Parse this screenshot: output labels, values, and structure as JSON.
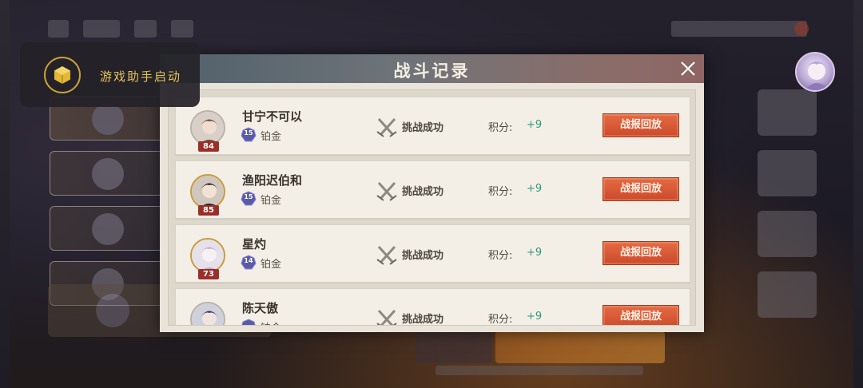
{
  "assistant": {
    "label": "游戏助手启动",
    "icon": "hexagon-box-icon"
  },
  "modal": {
    "title": "战斗记录",
    "close_icon": "close-icon"
  },
  "records": [
    {
      "name": "甘宁不可以",
      "level": "84",
      "rank_number": "15",
      "rank_name": "铂金",
      "result": "挑战成功",
      "score_label": "积分:",
      "score_value": "+9",
      "replay_label": "战报回放"
    },
    {
      "name": "渔阳迟伯和",
      "level": "85",
      "rank_number": "15",
      "rank_name": "铂金",
      "result": "挑战成功",
      "score_label": "积分:",
      "score_value": "+9",
      "replay_label": "战报回放"
    },
    {
      "name": "星灼",
      "level": "73",
      "rank_number": "14",
      "rank_name": "铂金",
      "result": "挑战成功",
      "score_label": "积分:",
      "score_value": "+9",
      "replay_label": "战报回放"
    },
    {
      "name": "陈天傲",
      "level": "",
      "rank_number": "",
      "rank_name": "铂金",
      "result": "挑战成功",
      "score_label": "积分:",
      "score_value": "+9",
      "replay_label": "战报回放"
    }
  ],
  "colors": {
    "accent_gold": "#e6c458",
    "replay_button": "#cc4a2a",
    "score_green": "#2f9a76",
    "level_badge": "#9a2e28"
  }
}
